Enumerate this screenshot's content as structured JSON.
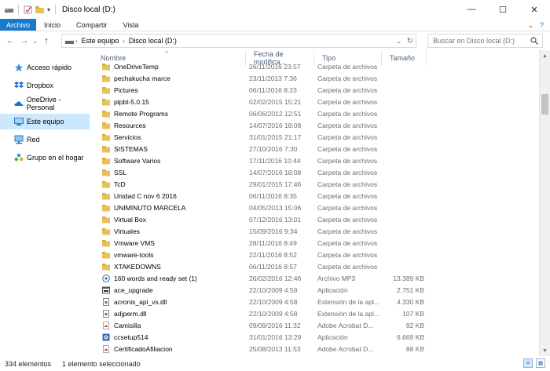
{
  "window": {
    "title": "Disco local (D:)",
    "minimize": "—",
    "maximize": "☐",
    "close": "✕"
  },
  "ribbon": {
    "tabs": [
      "Archivo",
      "Inicio",
      "Compartir",
      "Vista"
    ],
    "expand": "⌄",
    "help": "?"
  },
  "address": {
    "back": "←",
    "forward": "→",
    "recent": "⌄",
    "up": "↑",
    "crumbs": [
      "Este equipo",
      "Disco local (D:)"
    ],
    "dropdown": "⌄",
    "refresh": "↻"
  },
  "search": {
    "placeholder": "Buscar en Disco local (D:)"
  },
  "nav": {
    "items": [
      {
        "label": "Acceso rápido",
        "icon": "star-icon"
      },
      {
        "label": "Dropbox",
        "icon": "dropbox-icon"
      },
      {
        "label": "OneDrive - Personal",
        "icon": "cloud-icon"
      },
      {
        "label": "Este equipo",
        "icon": "computer-icon",
        "selected": true
      },
      {
        "label": "Red",
        "icon": "network-icon"
      },
      {
        "label": "Grupo en el hogar",
        "icon": "homegroup-icon"
      }
    ]
  },
  "columns": {
    "name": "Nombre",
    "date": "Fecha de modifica...",
    "type": "Tipo",
    "size": "Tamaño"
  },
  "files": [
    {
      "name": "OneDriveTemp",
      "date": "26/11/2016 23:57",
      "type": "Carpeta de archivos",
      "size": "",
      "icon": "folder"
    },
    {
      "name": "pechakucha marce",
      "date": "23/11/2013 7:36",
      "type": "Carpeta de archivos",
      "size": "",
      "icon": "folder"
    },
    {
      "name": "Pictures",
      "date": "06/11/2016 8:23",
      "type": "Carpeta de archivos",
      "size": "",
      "icon": "folder"
    },
    {
      "name": "plpbt-5.0.15",
      "date": "02/02/2015 15:21",
      "type": "Carpeta de archivos",
      "size": "",
      "icon": "folder"
    },
    {
      "name": "Remote Programs",
      "date": "06/06/2012 12:51",
      "type": "Carpeta de archivos",
      "size": "",
      "icon": "folder"
    },
    {
      "name": "Resources",
      "date": "14/07/2016 18:08",
      "type": "Carpeta de archivos",
      "size": "",
      "icon": "folder"
    },
    {
      "name": "Servicios",
      "date": "31/01/2015 21:17",
      "type": "Carpeta de archivos",
      "size": "",
      "icon": "folder"
    },
    {
      "name": "SISTEMAS",
      "date": "27/10/2016 7:30",
      "type": "Carpeta de archivos",
      "size": "",
      "icon": "folder"
    },
    {
      "name": "Software Varios",
      "date": "17/11/2016 10:44",
      "type": "Carpeta de archivos",
      "size": "",
      "icon": "folder"
    },
    {
      "name": "SSL",
      "date": "14/07/2016 18:08",
      "type": "Carpeta de archivos",
      "size": "",
      "icon": "folder"
    },
    {
      "name": "TcD",
      "date": "29/01/2015 17:46",
      "type": "Carpeta de archivos",
      "size": "",
      "icon": "folder"
    },
    {
      "name": "Unidad C nov 6 2016",
      "date": "06/11/2016 8:35",
      "type": "Carpeta de archivos",
      "size": "",
      "icon": "folder"
    },
    {
      "name": "UNIMINUTO MARCELA",
      "date": "04/05/2013 15:06",
      "type": "Carpeta de archivos",
      "size": "",
      "icon": "folder"
    },
    {
      "name": "Virtual Box",
      "date": "07/12/2016 13:01",
      "type": "Carpeta de archivos",
      "size": "",
      "icon": "folder"
    },
    {
      "name": "Virtuales",
      "date": "15/09/2016 9:34",
      "type": "Carpeta de archivos",
      "size": "",
      "icon": "folder"
    },
    {
      "name": "Vmware VMS",
      "date": "28/11/2016 8:49",
      "type": "Carpeta de archivos",
      "size": "",
      "icon": "folder"
    },
    {
      "name": "vmware-tools",
      "date": "22/11/2016 8:52",
      "type": "Carpeta de archivos",
      "size": "",
      "icon": "folder"
    },
    {
      "name": "XTAKEDOWNS",
      "date": "06/11/2016 8:57",
      "type": "Carpeta de archivos",
      "size": "",
      "icon": "folder"
    },
    {
      "name": "160 words and ready set (1)",
      "date": "26/02/2016 12:46",
      "type": "Archivo MP3",
      "size": "13.389 KB",
      "icon": "audio"
    },
    {
      "name": "ace_upgrade",
      "date": "22/10/2009 4:59",
      "type": "Aplicación",
      "size": "2.751 KB",
      "icon": "app"
    },
    {
      "name": "acronis_api_vs.dll",
      "date": "22/10/2009 4:58",
      "type": "Extensión de la apl...",
      "size": "4.330 KB",
      "icon": "dll"
    },
    {
      "name": "adjperm.dll",
      "date": "22/10/2009 4:58",
      "type": "Extensión de la apl...",
      "size": "107 KB",
      "icon": "dll"
    },
    {
      "name": "Camisilla",
      "date": "09/09/2016 11:32",
      "type": "Adobe Acrobat D...",
      "size": "92 KB",
      "icon": "pdf"
    },
    {
      "name": "ccsetup514",
      "date": "31/01/2016 13:29",
      "type": "Aplicación",
      "size": "6.669 KB",
      "icon": "setup"
    },
    {
      "name": "CertificadoAfiliacion",
      "date": "25/08/2013 11:53",
      "type": "Adobe Acrobat D...",
      "size": "88 KB",
      "icon": "pdf"
    }
  ],
  "status": {
    "count": "334 elementos",
    "selection": "1 elemento seleccionado"
  },
  "colors": {
    "accent": "#1979ca",
    "folder": "#e8c15a",
    "selected": "#cce8ff"
  }
}
